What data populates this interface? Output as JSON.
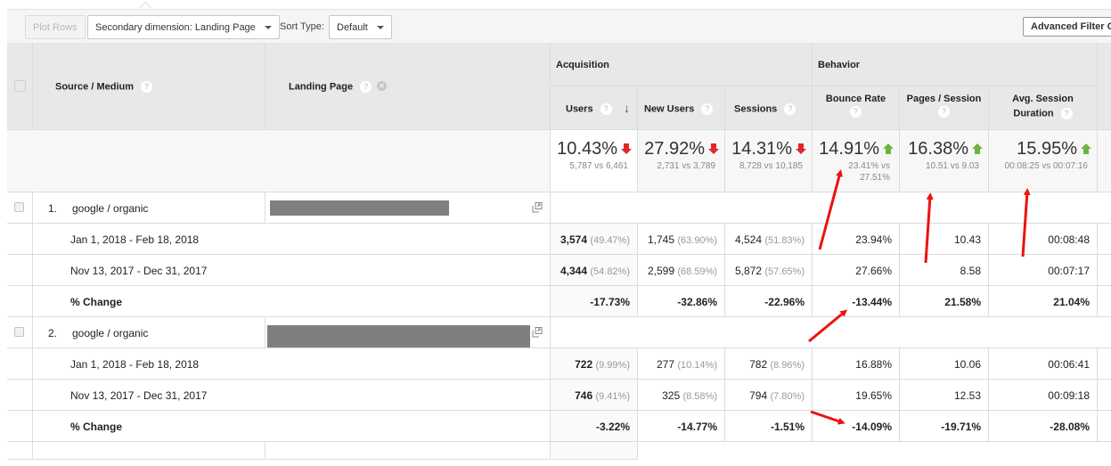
{
  "toolbar": {
    "plot_rows": "Plot Rows",
    "secondary_dimension": "Secondary dimension: Landing Page",
    "sort_type_label": "Sort Type:",
    "sort_type_value": "Default",
    "advanced_filter": "Advanced Filter O"
  },
  "headers": {
    "source_medium": "Source / Medium",
    "landing_page": "Landing Page",
    "acquisition": "Acquisition",
    "behavior": "Behavior",
    "users": "Users",
    "new_users": "New Users",
    "sessions": "Sessions",
    "bounce_rate": "Bounce Rate",
    "pages_session": "Pages / Session",
    "avg_session_line1": "Avg. Session",
    "avg_session_line2": "Duration",
    "help_glyph": "?",
    "sort_indicator": "↓"
  },
  "summary": {
    "users": {
      "change": "10.43%",
      "direction": "down",
      "compare": "5,787 vs 6,461"
    },
    "new_users": {
      "change": "27.92%",
      "direction": "down",
      "compare": "2,731 vs 3,789"
    },
    "sessions": {
      "change": "14.31%",
      "direction": "down",
      "compare": "8,728 vs 10,185"
    },
    "bounce_rate": {
      "change": "14.91%",
      "direction": "up",
      "compare_line1": "23.41% vs",
      "compare_line2": "27.51%"
    },
    "pages_session": {
      "change": "16.38%",
      "direction": "up",
      "compare": "10.51 vs 9.03"
    },
    "avg_duration": {
      "change": "15.95%",
      "direction": "up",
      "compare": "00:08:25 vs 00:07:16"
    }
  },
  "colors": {
    "down": "#e0262b",
    "up": "#6cb33f",
    "annotation": "#ee1111"
  },
  "rows": [
    {
      "index": "1.",
      "source_medium": "google / organic",
      "periods": [
        {
          "label": "Jan 1, 2018 - Feb 18, 2018",
          "users": "3,574",
          "users_pct": "(49.47%)",
          "new_users": "1,745",
          "new_users_pct": "(63.90%)",
          "sessions": "4,524",
          "sessions_pct": "(51.83%)",
          "bounce_rate": "23.94%",
          "pages_session": "10.43",
          "avg_duration": "00:08:48"
        },
        {
          "label": "Nov 13, 2017 - Dec 31, 2017",
          "users": "4,344",
          "users_pct": "(54.82%)",
          "new_users": "2,599",
          "new_users_pct": "(68.59%)",
          "sessions": "5,872",
          "sessions_pct": "(57.65%)",
          "bounce_rate": "27.66%",
          "pages_session": "8.58",
          "avg_duration": "00:07:17"
        }
      ],
      "change": {
        "label": "% Change",
        "users": "-17.73%",
        "new_users": "-32.86%",
        "sessions": "-22.96%",
        "bounce_rate": "-13.44%",
        "pages_session": "21.58%",
        "avg_duration": "21.04%"
      }
    },
    {
      "index": "2.",
      "source_medium": "google / organic",
      "periods": [
        {
          "label": "Jan 1, 2018 - Feb 18, 2018",
          "users": "722",
          "users_pct": "(9.99%)",
          "new_users": "277",
          "new_users_pct": "(10.14%)",
          "sessions": "782",
          "sessions_pct": "(8.96%)",
          "bounce_rate": "16.88%",
          "pages_session": "10.06",
          "avg_duration": "00:06:41"
        },
        {
          "label": "Nov 13, 2017 - Dec 31, 2017",
          "users": "746",
          "users_pct": "(9.41%)",
          "new_users": "325",
          "new_users_pct": "(8.58%)",
          "sessions": "794",
          "sessions_pct": "(7.80%)",
          "bounce_rate": "19.65%",
          "pages_session": "12.53",
          "avg_duration": "00:09:18"
        }
      ],
      "change": {
        "label": "% Change",
        "users": "-3.22%",
        "new_users": "-14.77%",
        "sessions": "-1.51%",
        "bounce_rate": "-14.09%",
        "pages_session": "-19.71%",
        "avg_duration": "-28.08%"
      }
    }
  ]
}
